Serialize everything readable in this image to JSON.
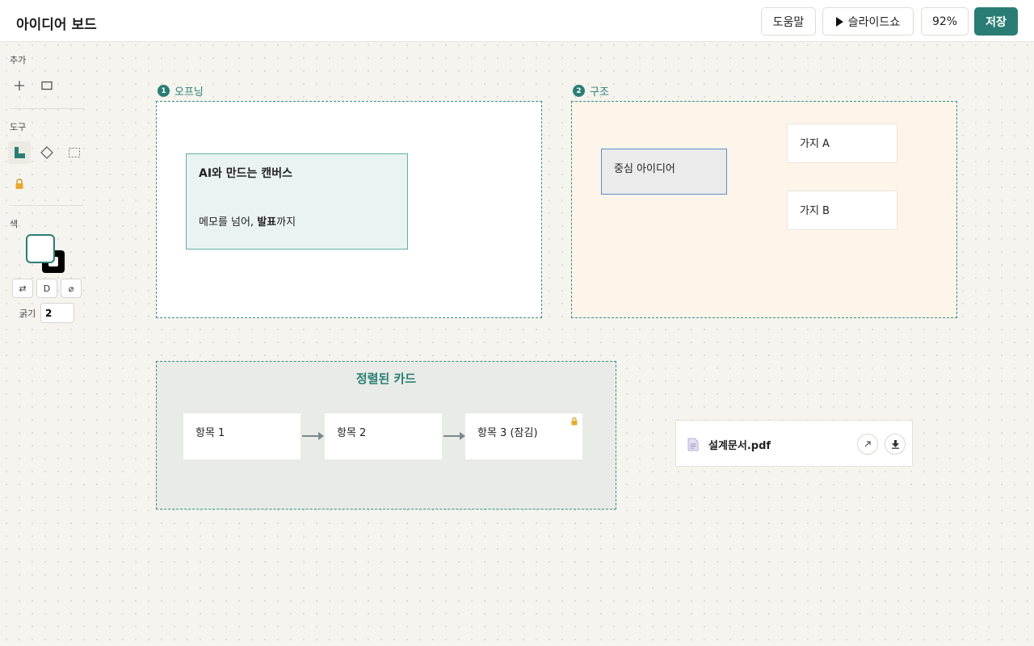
{
  "header": {
    "title": "아이디어 보드",
    "help_label": "도움말",
    "slideshow_label": "슬라이드쇼",
    "zoom": "92%",
    "save_label": "저장"
  },
  "sidebar": {
    "add_label": "추가",
    "tools_label": "도구",
    "color_label": "색",
    "swap_label": "⇄",
    "default_label": "D",
    "none_label": "⌀",
    "stroke_label": "굵기",
    "stroke_value": "2",
    "fill_color": "#ffffff",
    "stroke_color": "#000000"
  },
  "canvas": {
    "frame1": {
      "number": "1",
      "label": "오프닝",
      "card_title": "AI와 만드는 캔버스",
      "card_body_pre": "메모를 넘어, ",
      "card_body_bold": "발표",
      "card_body_post": "까지"
    },
    "frame2": {
      "number": "2",
      "label": "구조",
      "center": "중심 아이디어",
      "branch_a": "가지 A",
      "branch_b": "가지 B"
    },
    "frame3": {
      "title": "정렬된 카드",
      "items": [
        "항목 1",
        "항목 2",
        "항목 3 (잠김)"
      ]
    },
    "file": {
      "name": "설계문서.pdf"
    }
  },
  "colors": {
    "accent": "#2a7d74",
    "frame2_bg": "#fdf4ea",
    "frame3_bg": "#e9ebe6",
    "card1_bg": "#eaf3f1",
    "center_bg": "#ebebeb",
    "center_border": "#5b8fc8"
  }
}
